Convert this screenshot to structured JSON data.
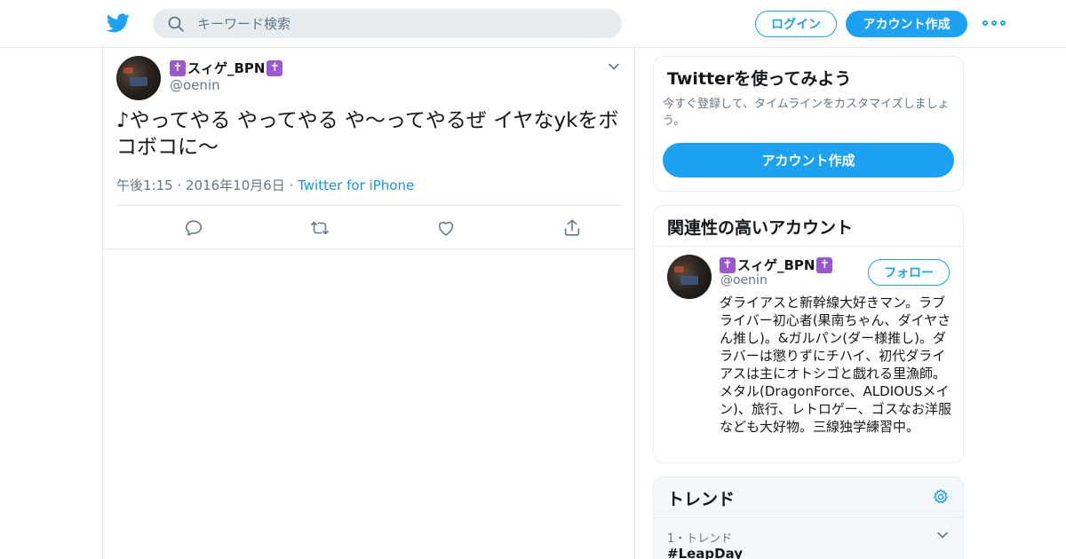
{
  "header": {
    "search_placeholder": "キーワード検索",
    "login_label": "ログイン",
    "signup_label": "アカウント作成"
  },
  "tweet": {
    "name": "スィゲ_BPN",
    "cross_glyph": "✝",
    "handle": "@oenin",
    "text": "♪やってやる やってやる や〜ってやるぜ イヤなykをボコボコに〜",
    "time": "午後1:15 · 2016年10月6日",
    "sep": " · ",
    "source": "Twitter for iPhone"
  },
  "signup_card": {
    "title": "Twitterを使ってみよう",
    "description": "今すぐ登録して、タイムラインをカスタマイズしましょう。",
    "button_label": "アカウント作成"
  },
  "related_card": {
    "title": "関連性の高いアカウント",
    "name": "スィゲ_BPN",
    "handle": "@oenin",
    "follow_label": "フォロー",
    "bio": "ダライアスと新幹線大好きマン。ラブライバー初心者(果南ちゃん、ダイヤさん推し)。&ガルパン(ダー様推し)。ダラバーは懲りずにチハイ、初代ダライアスは主にオトシゴと戯れる里漁師。メタル(DragonForce、ALDIOUSメイン)、旅行、レトロゲー、ゴスなお洋服なども大好物。三線独学練習中。"
  },
  "trends_card": {
    "title": "トレンド",
    "item_meta": "1・トレンド",
    "item_tag": "#LeapDay"
  },
  "colors": {
    "accent": "#1da1f2",
    "link": "#1b95e0",
    "muted": "#657786",
    "border": "#e1e8ed"
  }
}
